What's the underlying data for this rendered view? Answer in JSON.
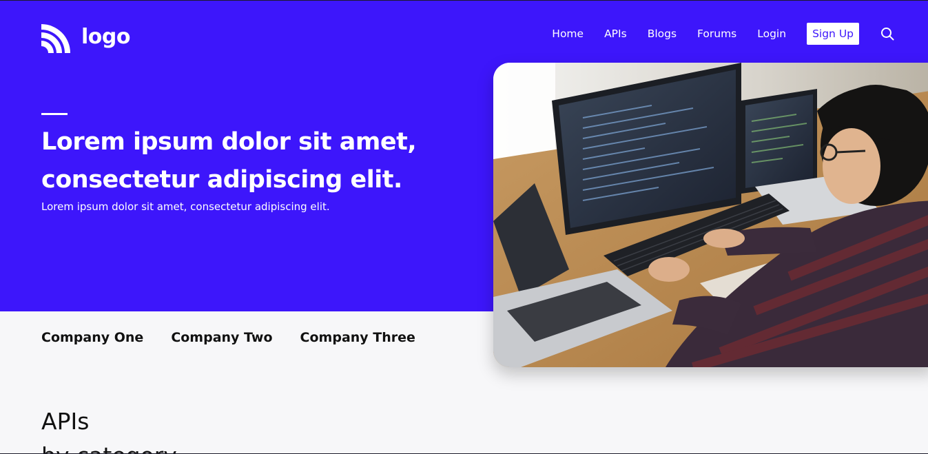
{
  "brand": {
    "logo_text": "logo",
    "primary_color": "#3d16fb",
    "logo_icon": "wifi-arcs-icon"
  },
  "nav": {
    "items": [
      {
        "label": "Home"
      },
      {
        "label": "APIs"
      },
      {
        "label": "Blogs"
      },
      {
        "label": "Forums"
      },
      {
        "label": "Login"
      }
    ],
    "signup_label": "Sign Up",
    "search_icon": "search-icon"
  },
  "hero": {
    "title": "Lorem ipsum dolor sit amet, consectetur adipiscing elit.",
    "subtitle": "Lorem ipsum dolor sit amet, consectetur adipiscing elit.",
    "image_subject": "person-coding-at-desk-photo"
  },
  "companies": [
    {
      "name": "Company One"
    },
    {
      "name": "Company Two"
    },
    {
      "name": "Company Three"
    }
  ],
  "apis_section": {
    "title": "APIs",
    "subtitle": "by category"
  }
}
